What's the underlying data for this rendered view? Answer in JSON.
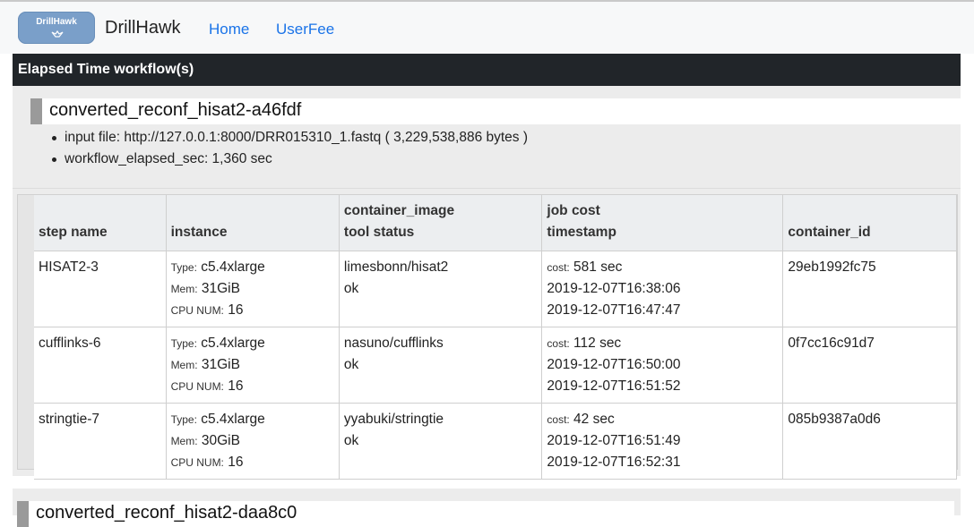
{
  "nav": {
    "logo_text": "DrillHawk",
    "brand": "DrillHawk",
    "links": [
      "Home",
      "UserFee"
    ]
  },
  "section": {
    "title": "Elapsed Time workflow(s)"
  },
  "workflows": [
    {
      "title": "converted_reconf_hisat2-a46fdf",
      "input_file": "input file: http://127.0.0.1:8000/DRR015310_1.fastq ( 3,229,538,886 bytes )",
      "elapsed": "workflow_elapsed_sec: 1,360 sec",
      "headers": {
        "step": "step name",
        "instance": "instance",
        "container_image": "container_image",
        "tool_status": "tool status",
        "job_cost": "job cost",
        "timestamp": "timestamp",
        "container_id": "container_id"
      },
      "labels": {
        "type": "Type:",
        "mem": "Mem:",
        "cpu": "CPU NUM:",
        "cost": "cost:"
      },
      "rows": [
        {
          "step": "HISAT2-3",
          "type": "c5.4xlarge",
          "mem": "31GiB",
          "cpu": "16",
          "image": "limesbonn/hisat2",
          "status": "ok",
          "cost": "581 sec",
          "start": "2019-12-07T16:38:06",
          "end": "2019-12-07T16:47:47",
          "container_id": "29eb1992fc75"
        },
        {
          "step": "cufflinks-6",
          "type": "c5.4xlarge",
          "mem": "31GiB",
          "cpu": "16",
          "image": "nasuno/cufflinks",
          "status": "ok",
          "cost": "112 sec",
          "start": "2019-12-07T16:50:00",
          "end": "2019-12-07T16:51:52",
          "container_id": "0f7cc16c91d7"
        },
        {
          "step": "stringtie-7",
          "type": "c5.4xlarge",
          "mem": "30GiB",
          "cpu": "16",
          "image": "yyabuki/stringtie",
          "status": "ok",
          "cost": "42 sec",
          "start": "2019-12-07T16:51:49",
          "end": "2019-12-07T16:52:31",
          "container_id": "085b9387a0d6"
        }
      ]
    },
    {
      "title": "converted_reconf_hisat2-daa8c0"
    }
  ]
}
